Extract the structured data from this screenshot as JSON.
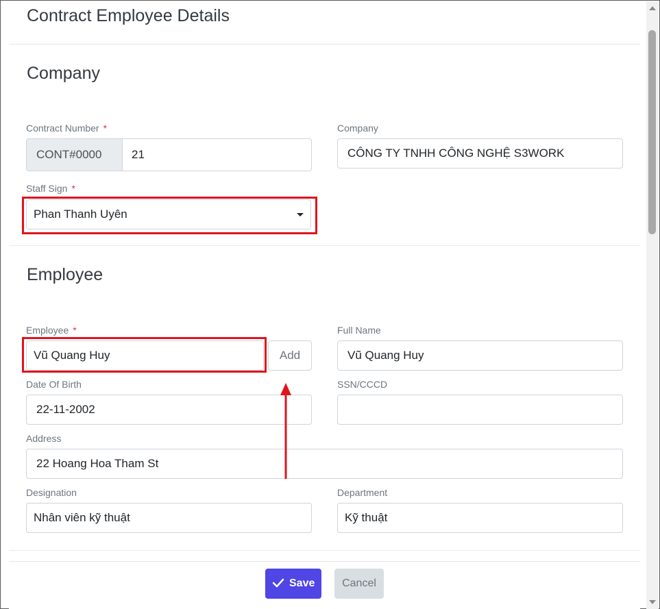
{
  "header": {
    "title": "Contract Employee Details"
  },
  "company_section": {
    "title": "Company",
    "contract_number": {
      "label": "Contract Number",
      "required_mark": "*",
      "prefix": "CONT#0000",
      "value": "21"
    },
    "company": {
      "label": "Company",
      "value": "CÔNG TY TNHH CÔNG NGHỆ S3WORK"
    },
    "staff_sign": {
      "label": "Staff Sign",
      "required_mark": "*",
      "value": "Phan Thanh Uyên"
    }
  },
  "employee_section": {
    "title": "Employee",
    "employee": {
      "label": "Employee",
      "required_mark": "*",
      "value": "Vũ Quang Huy",
      "add_label": "Add"
    },
    "full_name": {
      "label": "Full Name",
      "value": "Vũ Quang Huy"
    },
    "date_of_birth": {
      "label": "Date Of Birth",
      "value": "22-11-2002"
    },
    "ssn": {
      "label": "SSN/CCCD",
      "value": ""
    },
    "address": {
      "label": "Address",
      "value": "22 Hoang Hoa Tham St"
    },
    "designation": {
      "label": "Designation",
      "value": "Nhân viên kỹ thuật"
    },
    "department": {
      "label": "Department",
      "value": "Kỹ thuật"
    }
  },
  "footer": {
    "save_label": "Save",
    "cancel_label": "Cancel"
  },
  "colors": {
    "primary": "#4f46e5",
    "highlight": "#e0141e",
    "required": "#dc3545"
  }
}
